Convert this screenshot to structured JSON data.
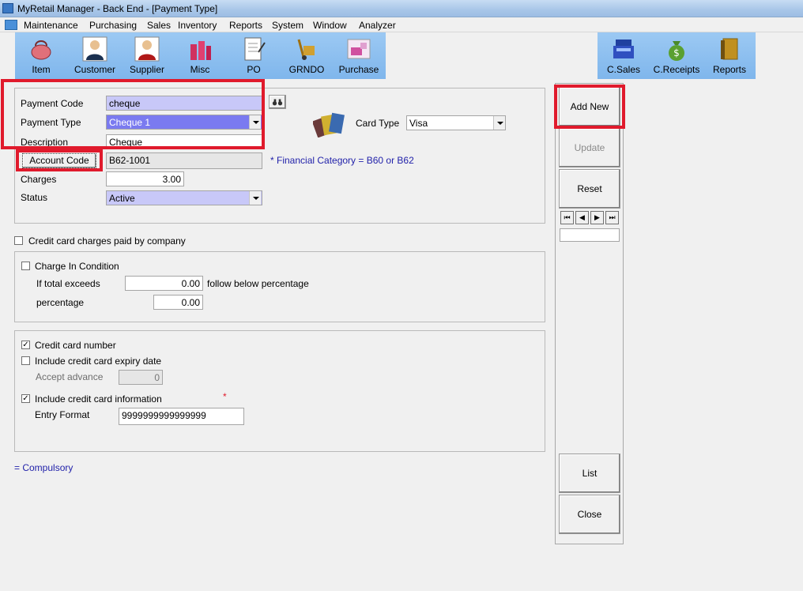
{
  "window": {
    "title": "MyRetail Manager - Back End - [Payment Type]"
  },
  "menu": [
    "Maintenance",
    "Purchasing",
    "Sales",
    "Inventory",
    "Reports",
    "System",
    "Window",
    "Analyzer"
  ],
  "toolbar": {
    "left": [
      {
        "label": "Item",
        "icon": "handbag-icon"
      },
      {
        "label": "Customer",
        "icon": "customer-icon"
      },
      {
        "label": "Supplier",
        "icon": "supplier-icon"
      },
      {
        "label": "Misc",
        "icon": "misc-icon"
      },
      {
        "label": "PO",
        "icon": "po-icon"
      },
      {
        "label": "GRNDO",
        "icon": "hand-truck-icon"
      },
      {
        "label": "Purchase",
        "icon": "purchase-icon"
      }
    ],
    "right": [
      {
        "label": "C.Sales",
        "icon": "cash-register-icon"
      },
      {
        "label": "C.Receipts",
        "icon": "money-bag-icon"
      },
      {
        "label": "Reports",
        "icon": "reports-book-icon"
      }
    ]
  },
  "form": {
    "payment_code_label": "Payment Code",
    "payment_code": "cheque",
    "payment_type_label": "Payment Type",
    "payment_type": "Cheque 1",
    "description_label": "Description",
    "description": "Cheque",
    "account_code_button": "Account Code",
    "account_code": "B62-1001",
    "financial_note": "* Financial Category = B60 or B62",
    "charges_label": "Charges",
    "charges": "3.00",
    "status_label": "Status",
    "status": "Active",
    "card_type_label": "Card Type",
    "card_type": "Visa"
  },
  "company_charges": {
    "label": "Credit card charges paid by company",
    "checked": false
  },
  "charge_condition": {
    "label": "Charge In Condition",
    "checked": false,
    "total_exceeds_label": "If total exceeds",
    "total_exceeds": "0.00",
    "follow_label": "follow below percentage",
    "percentage_label": "percentage",
    "percentage": "0.00"
  },
  "card_options": {
    "card_number_label": "Credit card number",
    "card_number_checked": true,
    "expiry_label": "Include credit card expiry date",
    "expiry_checked": false,
    "accept_advance_label": "Accept advance",
    "accept_advance": "0",
    "info_label": "Include credit card information",
    "info_checked": true,
    "required_mark": "*",
    "entry_format_label": "Entry Format",
    "entry_format": "9999999999999999"
  },
  "compulsory_note": "= Compulsory",
  "actions": {
    "add_new": "Add New",
    "update": "Update",
    "reset": "Reset",
    "list": "List",
    "close": "Close"
  },
  "record_nav": {
    "first": "⏮",
    "prev": "◀",
    "next": "▶",
    "last": "⏭"
  },
  "colors": {
    "highlight": "#e01a2c",
    "toolbar": "#8fc0f0",
    "info_text": "#2222aa"
  }
}
